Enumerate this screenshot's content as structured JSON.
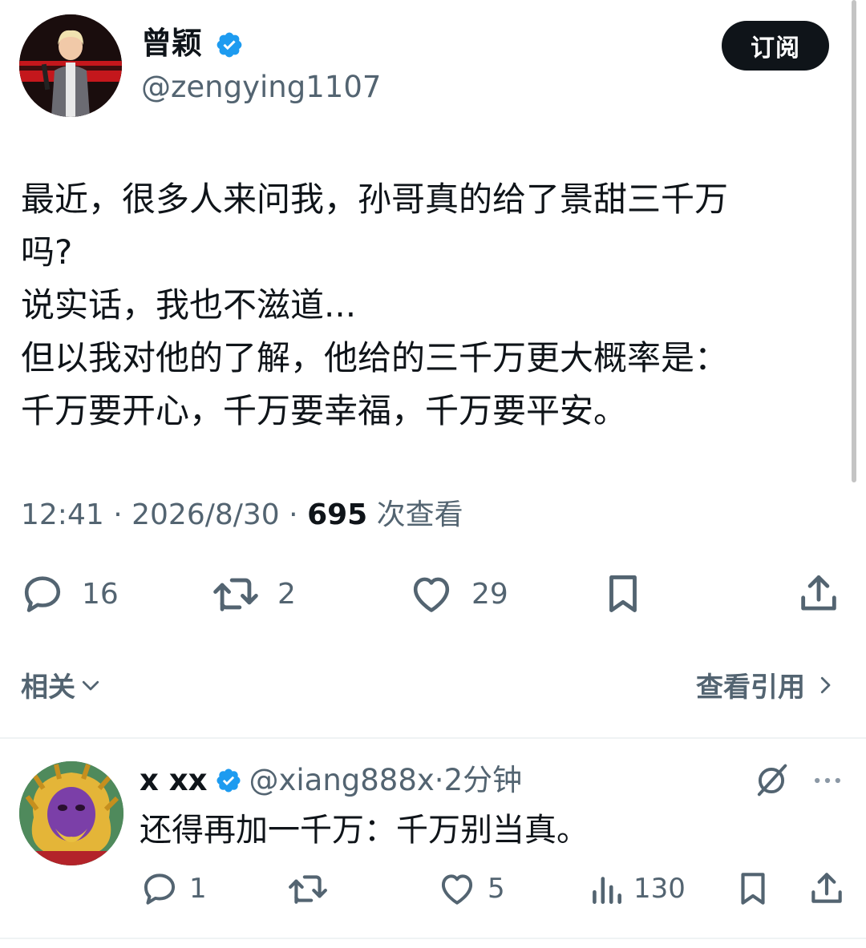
{
  "tweet": {
    "author_name": "曾颖",
    "author_handle": "@zengying1107",
    "subscribe_label": "订阅",
    "lines": [
      "最近，很多人来问我，孙哥真的给了景甜三千万",
      "吗?",
      "说实话，我也不滋道...",
      "但以我对他的了解，他给的三千万更大概率是：",
      "千万要开心，千万要幸福，千万要平安。"
    ],
    "time": "12:41",
    "date": "2026/8/30",
    "views_count": "695",
    "views_label": "次查看",
    "separator": "·",
    "stats": {
      "replies": "16",
      "reposts": "2",
      "likes": "29"
    }
  },
  "related": {
    "label": "相关",
    "quotes_label": "查看引用"
  },
  "reply": {
    "author_name": "x xx",
    "author_handle": "@xiang888x",
    "time_ago": "2分钟",
    "separator": "·",
    "text": "还得再加一千万：千万别当真。",
    "stats": {
      "replies": "1",
      "likes": "5",
      "views": "130"
    }
  },
  "colors": {
    "accent": "#1d9bf0",
    "text": "#0f1419",
    "secondary": "#536471",
    "button": "#0f1419"
  },
  "icons": [
    "verified-badge-icon",
    "reply-icon",
    "repost-icon",
    "like-icon",
    "bookmark-icon",
    "share-icon",
    "chevron-down-icon",
    "chevron-right-icon",
    "grok-icon",
    "more-icon",
    "views-icon"
  ]
}
